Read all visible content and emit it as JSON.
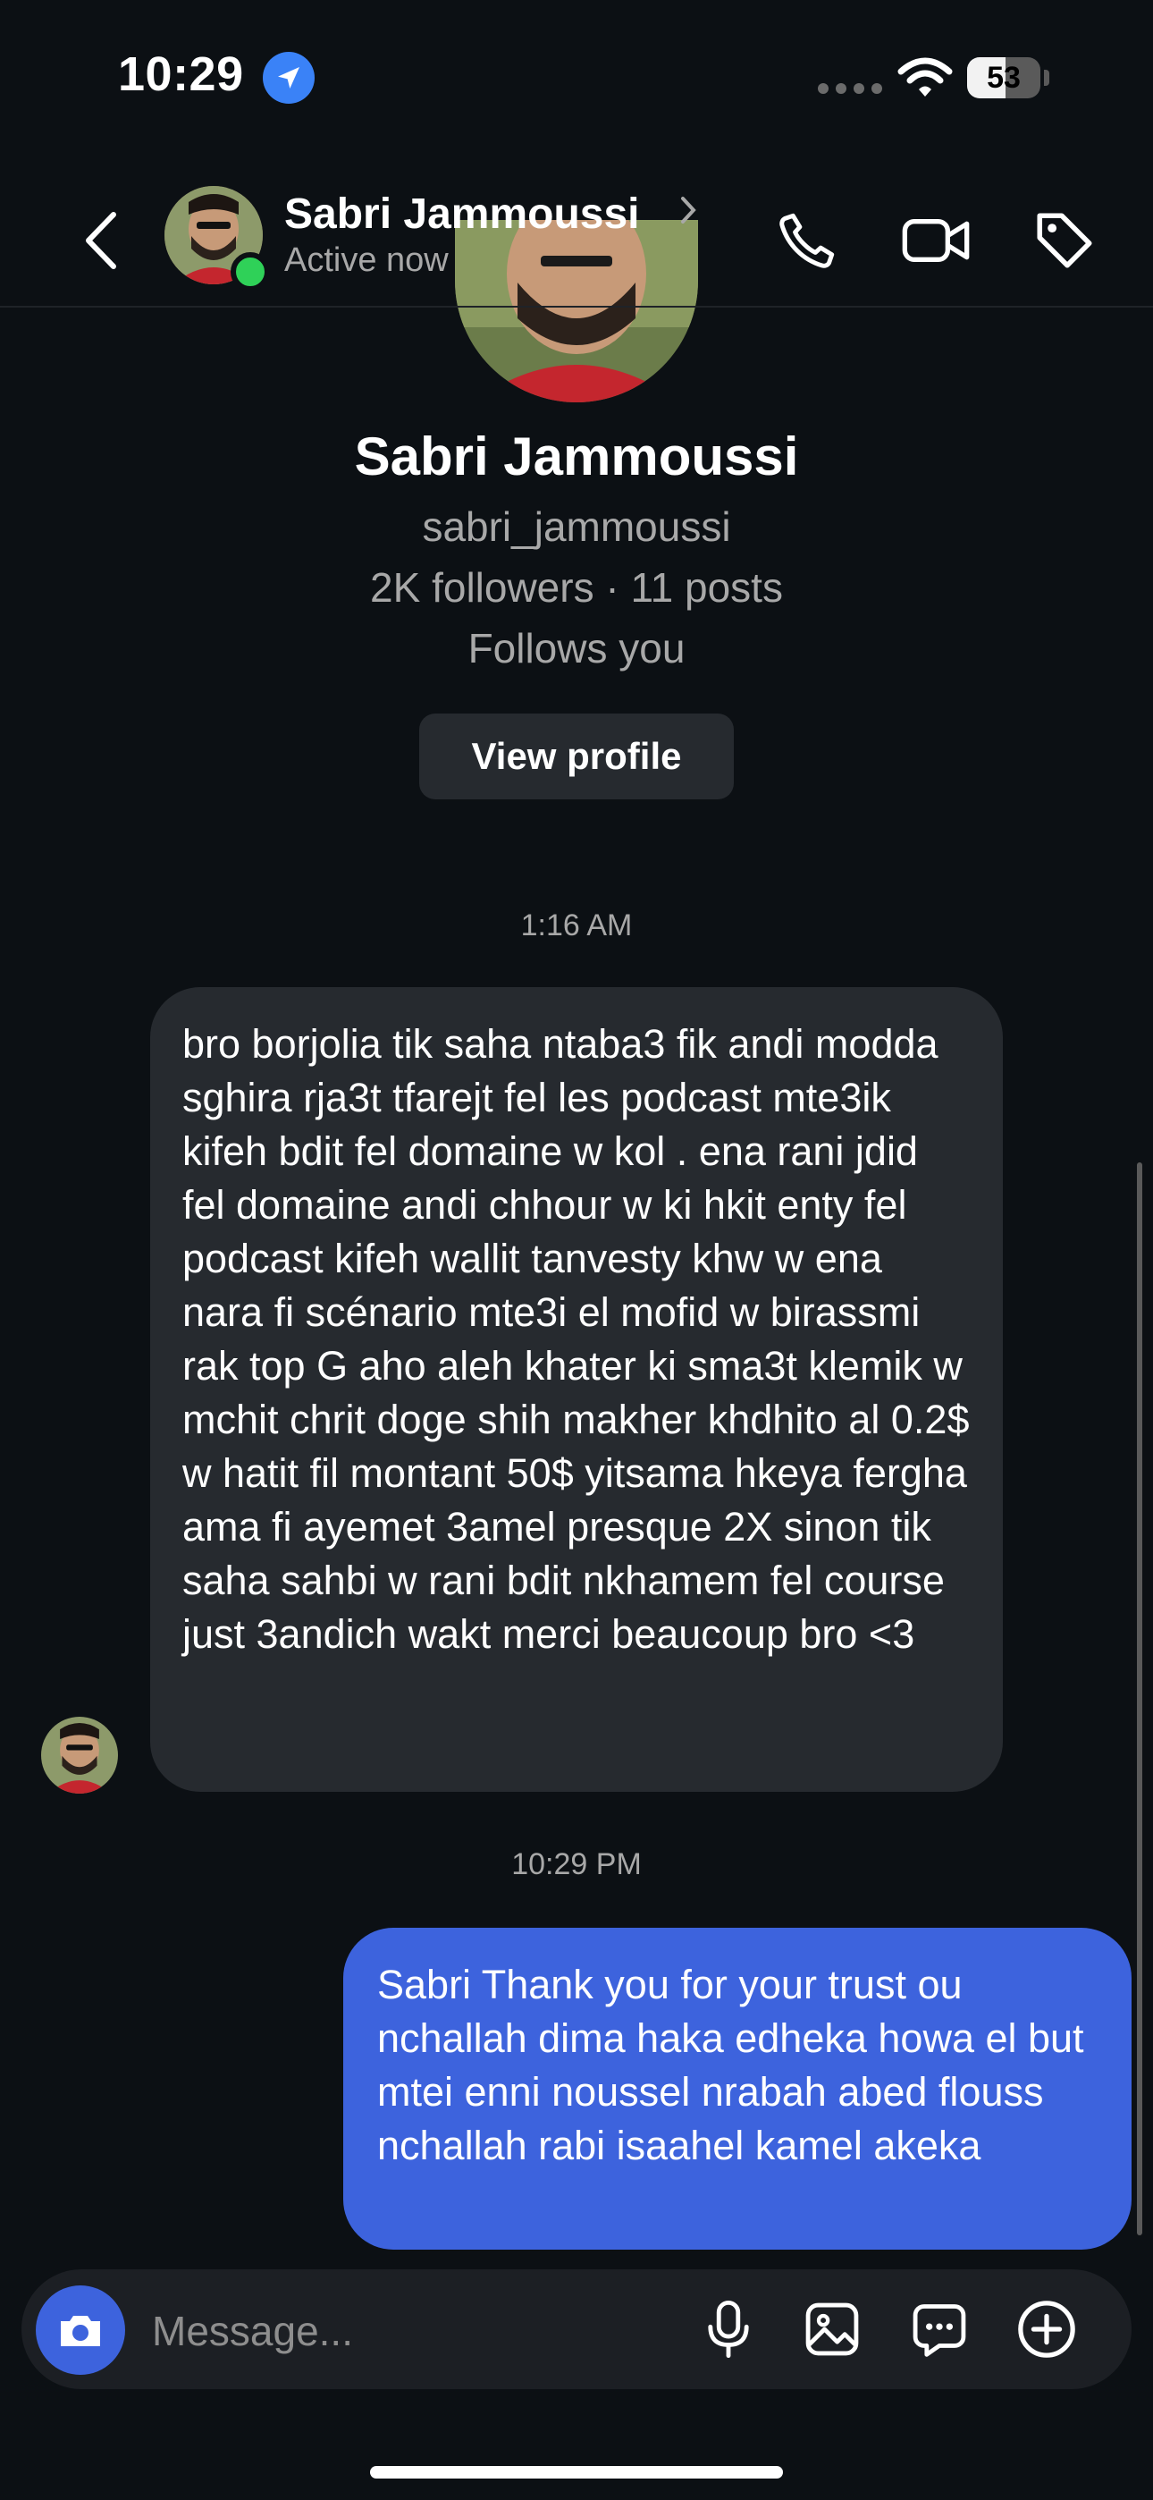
{
  "status_bar": {
    "time": "10:29",
    "battery": "53",
    "battery_level": 0.53,
    "location_icon": "location-arrow-icon",
    "wifi_icon": "wifi-icon"
  },
  "header": {
    "name": "Sabri Jammoussi",
    "status": "Active now",
    "icons": [
      "back-chevron-icon",
      "chevron-right-icon",
      "phone-icon",
      "video-camera-icon",
      "tag-icon"
    ]
  },
  "profile": {
    "name": "Sabri Jammoussi",
    "username": "sabri_jammoussi",
    "stats": "2K followers · 11 posts",
    "follows": "Follows you",
    "view_profile_label": "View profile"
  },
  "messages": [
    {
      "timestamp": "1:16 AM",
      "direction": "incoming",
      "text": "bro borjolia tik saha ntaba3 fik andi modda sghira rja3t tfarejt fel les podcast mte3ik kifeh bdit fel domaine w kol . ena rani jdid fel domaine andi chhour w ki hkit enty fel podcast kifeh wallit tanvesty khw w ena nara fi scénario mte3i el mofid w birassmi rak top G aho aleh khater ki sma3t klemik w mchit chrit doge shih makher khdhito al 0.2$ w hatit fil montant 50$ yitsama hkeya fergha ama fi ayemet 3amel presque 2X sinon tik saha sahbi w rani bdit nkhamem fel course just 3andich wakt merci beaucoup bro <3"
    },
    {
      "timestamp": "10:29 PM",
      "direction": "outgoing",
      "text": "Sabri Thank you for your trust ou nchallah dima haka edheka howa el but mtei enni noussel nrabah abed flouss nchallah rabi isaahel kamel akeka"
    }
  ],
  "composer": {
    "placeholder": "Message...",
    "icons": [
      "camera-icon",
      "microphone-icon",
      "gallery-icon",
      "sticker-icon",
      "plus-icon"
    ]
  },
  "colors": {
    "background": "#0c1014",
    "incoming_bubble": "#262a2f",
    "outgoing_bubble": "#3d63dd",
    "online": "#2fd158",
    "location_badge": "#3a82f7"
  }
}
